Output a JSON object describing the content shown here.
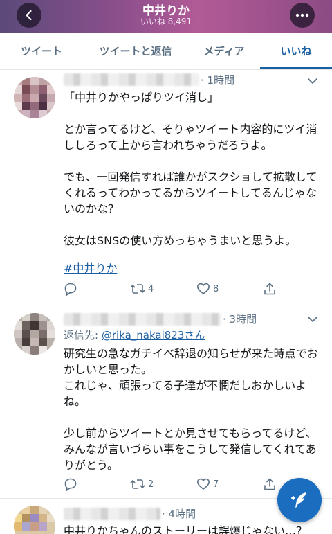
{
  "header": {
    "title": "中井りか",
    "subtitle": "いいね 8,491",
    "back_icon": "chevron-left-icon",
    "more_icon": "more-horizontal-icon",
    "gradient": [
      "#5b4a7a",
      "#b25a96"
    ]
  },
  "tabs": [
    {
      "label": "ツイート",
      "active": false
    },
    {
      "label": "ツイートと返信",
      "active": false
    },
    {
      "label": "メディア",
      "active": false
    },
    {
      "label": "いいね",
      "active": true
    }
  ],
  "colors": {
    "accent": "#1b5fa3",
    "muted": "#5b7083",
    "fab": "#1b6dc0"
  },
  "tweets": [
    {
      "time": "· 1時間",
      "text": "「中井りかやっぱりツイ消し」\n\nとか言ってるけど、そりゃツイート内容的にツイ消ししろって上から言われちゃうだろうよ。\n\nでも、一回発信すれば誰かがスクショして拡散してくれるってわかってるからツイートしてるんじゃないのかな？\n\n彼女はSNSの使い方めっちゃうまいと思うよ。",
      "hashtag": "#中井りか",
      "retweets": "4",
      "likes": "8"
    },
    {
      "time": "· 3時間",
      "reply_label": "返信先: ",
      "reply_handle": "@rika_nakai823さん",
      "text": "研究生の急なガチイベ辞退の知らせが来た時点でおかしいと思った。\nこれじゃ、頑張ってる子達が不憫だしおかしいよね。\n\n少し前からツイートとか見させてもらってるけど、みんなが言いづらい事をこうして発信してくれてありがとう。",
      "retweets": "2",
      "likes": "7"
    },
    {
      "time": "· 4時間",
      "text": "中井りかちゃんのストーリーは誤爆じゃない…？"
    }
  ],
  "fab": {
    "icon": "compose-feather-icon"
  }
}
